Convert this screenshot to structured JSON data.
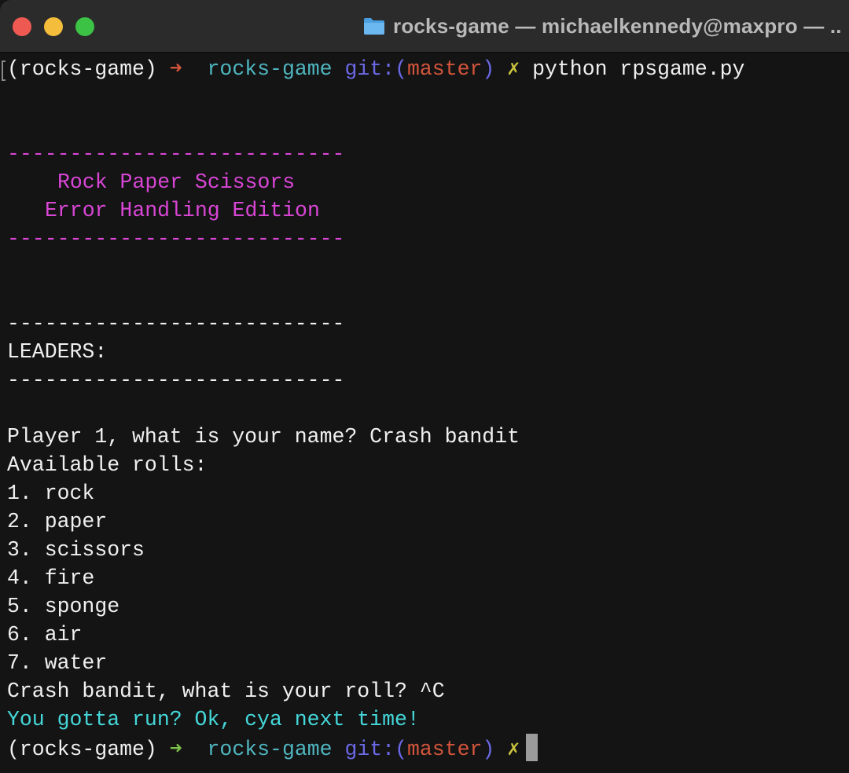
{
  "window": {
    "title": "rocks-game — michaelkennedy@maxpro — ..",
    "folder_icon": "folder-icon",
    "colors": {
      "close": "#ee5a52",
      "minimize": "#f4bd3c",
      "maximize": "#3cc245"
    }
  },
  "prompt": {
    "env": "(rocks-game)",
    "arrow": "➜",
    "dir": "rocks-game",
    "git_prefix": "git:(",
    "branch": "master",
    "git_suffix": ")",
    "dirty": "✗",
    "command": "python rpsgame.py"
  },
  "banner": {
    "rule": "---------------------------",
    "title": "Rock Paper Scissors",
    "subtitle": "Error Handling Edition"
  },
  "leaders": {
    "rule": "---------------------------",
    "label": "LEADERS:"
  },
  "game": {
    "name_prompt": "Player 1, what is your name? Crash bandit",
    "rolls_header": "Available rolls:",
    "rolls": [
      "1. rock",
      "2. paper",
      "3. scissors",
      "4. fire",
      "5. sponge",
      "6. air",
      "7. water"
    ],
    "roll_prompt": "Crash bandit, what is your roll? ^C",
    "exit_message": "You gotta run? Ok, cya next time!"
  },
  "colors": {
    "banner": "#d946d6",
    "exit_message": "#45d7d9",
    "arrow_error": "#d2553b",
    "arrow_ok": "#7bc04a",
    "dir": "#4fb6c0",
    "git": "#6b68e6",
    "branch": "#d2553b",
    "dirty": "#c9c23e"
  }
}
